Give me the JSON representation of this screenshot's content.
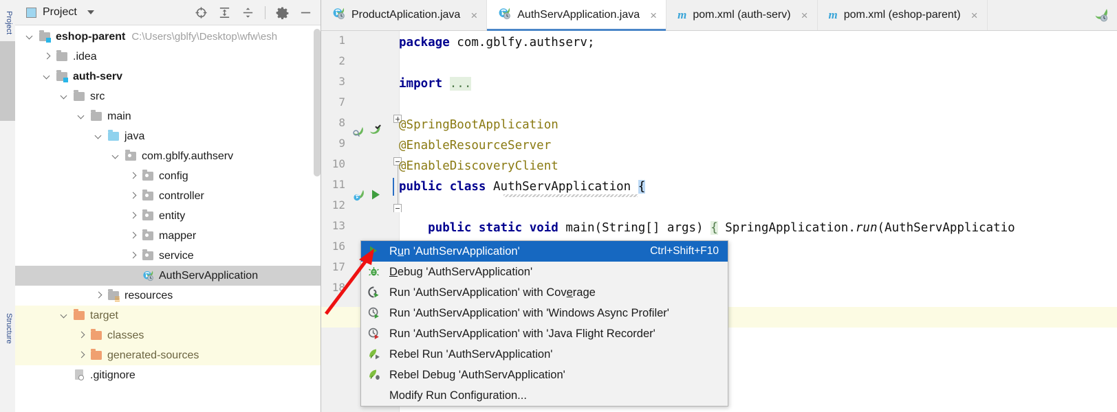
{
  "window": {
    "left_stripe": [
      "Project",
      "Structure"
    ]
  },
  "project_panel": {
    "title": "Project",
    "toolbar": [
      {
        "name": "locate-icon",
        "label": "Select Opened File"
      },
      {
        "name": "expand-all-icon",
        "label": "Expand All"
      },
      {
        "name": "collapse-all-icon",
        "label": "Collapse All"
      },
      {
        "name": "gear-icon",
        "label": "Settings"
      },
      {
        "name": "minimize-icon",
        "label": "Hide"
      }
    ],
    "tree": [
      {
        "label": "eshop-parent",
        "path": "C:\\Users\\gblfy\\Desktop\\wfw\\esh",
        "indent": 0,
        "arrow": "down",
        "icon": "module-folder",
        "bold": true,
        "state": "normal"
      },
      {
        "label": ".idea",
        "path": "",
        "indent": 1,
        "arrow": "right",
        "icon": "grey-folder",
        "bold": false,
        "state": "normal"
      },
      {
        "label": "auth-serv",
        "path": "",
        "indent": 1,
        "arrow": "down",
        "icon": "module-folder",
        "bold": true,
        "state": "normal"
      },
      {
        "label": "src",
        "path": "",
        "indent": 2,
        "arrow": "down",
        "icon": "grey-folder",
        "bold": false,
        "state": "normal"
      },
      {
        "label": "main",
        "path": "",
        "indent": 3,
        "arrow": "down",
        "icon": "grey-folder",
        "bold": false,
        "state": "normal"
      },
      {
        "label": "java",
        "path": "",
        "indent": 4,
        "arrow": "down",
        "icon": "blue-folder",
        "bold": false,
        "state": "normal"
      },
      {
        "label": "com.gblfy.authserv",
        "path": "",
        "indent": 5,
        "arrow": "down",
        "icon": "package",
        "bold": false,
        "state": "normal"
      },
      {
        "label": "config",
        "path": "",
        "indent": 6,
        "arrow": "right",
        "icon": "package",
        "bold": false,
        "state": "normal"
      },
      {
        "label": "controller",
        "path": "",
        "indent": 6,
        "arrow": "right",
        "icon": "package",
        "bold": false,
        "state": "normal"
      },
      {
        "label": "entity",
        "path": "",
        "indent": 6,
        "arrow": "right",
        "icon": "package",
        "bold": false,
        "state": "normal"
      },
      {
        "label": "mapper",
        "path": "",
        "indent": 6,
        "arrow": "right",
        "icon": "package",
        "bold": false,
        "state": "normal"
      },
      {
        "label": "service",
        "path": "",
        "indent": 6,
        "arrow": "right",
        "icon": "package",
        "bold": false,
        "state": "normal"
      },
      {
        "label": "AuthServApplication",
        "path": "",
        "indent": 6,
        "arrow": "none",
        "icon": "spring-class",
        "bold": false,
        "state": "selected"
      },
      {
        "label": "resources",
        "path": "",
        "indent": 4,
        "arrow": "right",
        "icon": "resources-folder",
        "bold": false,
        "state": "normal"
      },
      {
        "label": "target",
        "path": "",
        "indent": 2,
        "arrow": "down",
        "icon": "orange-folder",
        "bold": false,
        "state": "excluded"
      },
      {
        "label": "classes",
        "path": "",
        "indent": 3,
        "arrow": "right",
        "icon": "orange-folder",
        "bold": false,
        "state": "excluded"
      },
      {
        "label": "generated-sources",
        "path": "",
        "indent": 3,
        "arrow": "right",
        "icon": "orange-folder",
        "bold": false,
        "state": "excluded"
      },
      {
        "label": ".gitignore",
        "path": "",
        "indent": 2,
        "arrow": "none",
        "icon": "ignored-file",
        "bold": false,
        "state": "normal"
      }
    ]
  },
  "editor": {
    "tabs": [
      {
        "label": "ProductAplication.java",
        "icon": "spring-class-icon",
        "active": false,
        "close": "×"
      },
      {
        "label": "AuthServApplication.java",
        "icon": "spring-class-icon",
        "active": true,
        "close": "×"
      },
      {
        "label": "pom.xml (auth-serv)",
        "icon": "maven-icon",
        "active": false,
        "close": "×"
      },
      {
        "label": "pom.xml (eshop-parent)",
        "icon": "maven-icon",
        "active": false,
        "close": "×"
      }
    ],
    "tab_far_icon": "spring-boot-leaf-icon",
    "line_numbers": [
      "1",
      "2",
      "3",
      "7",
      "8",
      "9",
      "10",
      "11",
      "12",
      "13",
      "16",
      "17",
      "18"
    ],
    "highlighted_line": "17",
    "code": {
      "l1_kw": "package",
      "l1_rest": " com.gblfy.authserv;",
      "l3_kw": "import",
      "l3_fold": "...",
      "l8": "@SpringBootApplication",
      "l9": "@EnableResourceServer",
      "l10": "@EnableDiscoveryClient",
      "l11_kw1": "public",
      "l11_kw2": "class",
      "l11_name": "AuthServApplication",
      "l11_brace": "{",
      "l13_kw1": "public",
      "l13_kw2": "static",
      "l13_kw3": "void",
      "l13_name": "main",
      "l13_params": "(String[] args)",
      "l13_brace": "{",
      "l13_call_obj": "SpringApplication.",
      "l13_call_m": "run",
      "l13_call_arg": "(AuthServApplicatio"
    }
  },
  "context_menu": {
    "items": [
      {
        "label": "Run 'AuthServApplication'",
        "mnemonic_index": 1,
        "shortcut": "Ctrl+Shift+F10",
        "icon": "run-green-triangle-icon",
        "highlighted": true
      },
      {
        "label": "Debug 'AuthServApplication'",
        "mnemonic_index": 0,
        "shortcut": "",
        "icon": "debug-bug-icon",
        "highlighted": false
      },
      {
        "label": "Run 'AuthServApplication' with Coverage",
        "mnemonic_index": 34,
        "shortcut": "",
        "icon": "coverage-icon",
        "highlighted": false
      },
      {
        "label": "Run 'AuthServApplication' with 'Windows Async Profiler'",
        "mnemonic_index": -1,
        "shortcut": "",
        "icon": "profiler-clock-icon",
        "highlighted": false
      },
      {
        "label": "Run 'AuthServApplication' with 'Java Flight Recorder'",
        "mnemonic_index": -1,
        "shortcut": "",
        "icon": "flight-recorder-icon",
        "highlighted": false
      },
      {
        "label": "Rebel Run 'AuthServApplication'",
        "mnemonic_index": -1,
        "shortcut": "",
        "icon": "jrebel-run-icon",
        "highlighted": false
      },
      {
        "label": "Rebel Debug 'AuthServApplication'",
        "mnemonic_index": -1,
        "shortcut": "",
        "icon": "jrebel-debug-icon",
        "highlighted": false
      },
      {
        "label": "Modify Run Configuration...",
        "mnemonic_index": -1,
        "shortcut": "",
        "icon": "none",
        "highlighted": false
      }
    ]
  },
  "annotation": {
    "arrow_color": "#ee1111",
    "points_to": "Run 'AuthServApplication'"
  },
  "colors": {
    "selection_blue": "#1668c1",
    "tab_underline": "#4a86c8",
    "excluded_bg": "#fcfbe3",
    "tree_selected_bg": "#d0d0d0",
    "annotation": "#8a7a12",
    "keyword": "#00008f"
  }
}
